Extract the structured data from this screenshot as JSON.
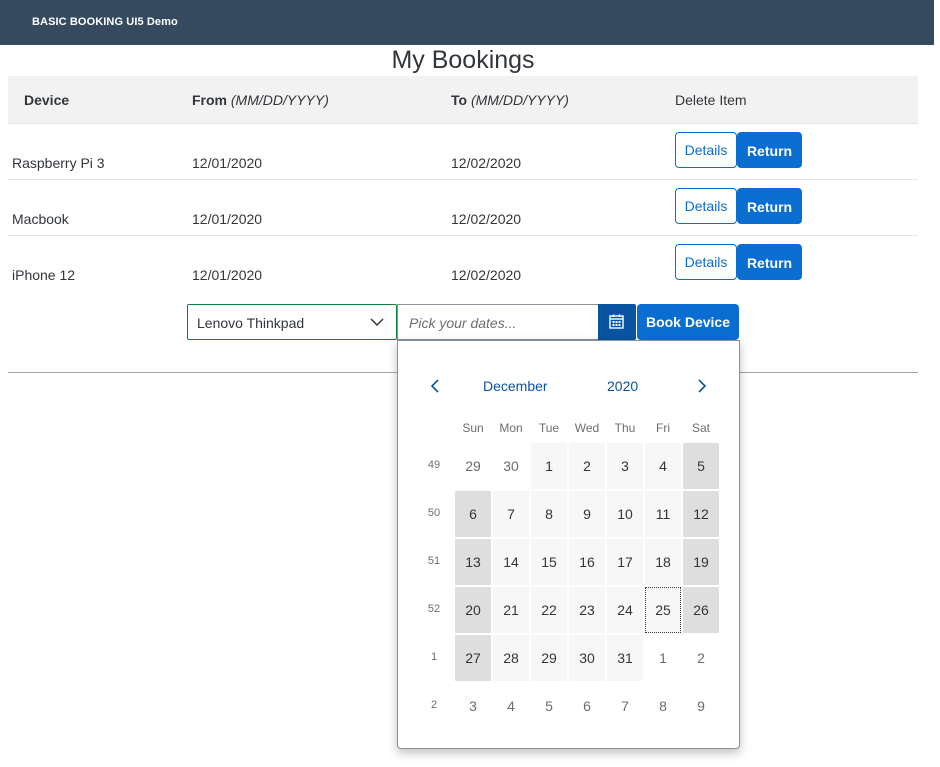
{
  "shell": {
    "title": "BASIC BOOKING UI5 Demo"
  },
  "page": {
    "title": "My Bookings"
  },
  "table": {
    "headers": {
      "device": "Device",
      "from_label": "From",
      "from_format": "(MM/DD/YYYY)",
      "to_label": "To",
      "to_format": "(MM/DD/YYYY)",
      "delete": "Delete Item"
    },
    "rows": [
      {
        "device": "Raspberry Pi 3",
        "from": "12/01/2020",
        "to": "12/02/2020",
        "details": "Details",
        "return": "Return"
      },
      {
        "device": "Macbook",
        "from": "12/01/2020",
        "to": "12/02/2020",
        "details": "Details",
        "return": "Return"
      },
      {
        "device": "iPhone 12",
        "from": "12/01/2020",
        "to": "12/02/2020",
        "details": "Details",
        "return": "Return"
      }
    ]
  },
  "booking": {
    "device_selected": "Lenovo Thinkpad",
    "date_placeholder": "Pick your dates...",
    "book_label": "Book Device"
  },
  "calendar": {
    "month": "December",
    "year": "2020",
    "weekdays": [
      "Sun",
      "Mon",
      "Tue",
      "Wed",
      "Thu",
      "Fri",
      "Sat"
    ],
    "weeks": [
      "49",
      "50",
      "51",
      "52",
      "1",
      "2"
    ],
    "days": [
      [
        "29",
        "30",
        "1",
        "2",
        "3",
        "4",
        "5"
      ],
      [
        "6",
        "7",
        "8",
        "9",
        "10",
        "11",
        "12"
      ],
      [
        "13",
        "14",
        "15",
        "16",
        "17",
        "18",
        "19"
      ],
      [
        "20",
        "21",
        "22",
        "23",
        "24",
        "25",
        "26"
      ],
      [
        "27",
        "28",
        "29",
        "30",
        "31",
        "1",
        "2"
      ],
      [
        "3",
        "4",
        "5",
        "6",
        "7",
        "8",
        "9"
      ]
    ],
    "today": "25",
    "icons": {
      "prev": "chevron-left-icon",
      "next": "chevron-right-icon",
      "picker": "calendar-icon",
      "dropdown": "chevron-down-icon"
    }
  },
  "colors": {
    "shell": "#354a5f",
    "accent": "#0a6ed1",
    "picker_button": "#0854a0",
    "select_border": "#107e3e"
  }
}
